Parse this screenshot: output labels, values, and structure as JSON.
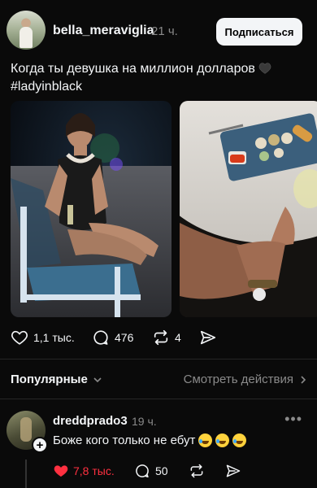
{
  "post": {
    "username": "bella_meraviglia",
    "time": "21 ч.",
    "subscribe_label": "Подписаться",
    "caption_line1": "Когда ты девушка на миллион долларов",
    "caption_line2": "#ladyinblack",
    "likes": "1,1 тыс.",
    "replies": "476",
    "reposts": "4"
  },
  "sort": {
    "label": "Популярные",
    "activity_link": "Смотреть действия"
  },
  "comment": {
    "username": "dreddprado3",
    "time": "19 ч.",
    "text": "Боже кого только не ебут",
    "likes": "7,8 тыс.",
    "replies": "50"
  },
  "colors": {
    "background": "#0a0a0a",
    "text": "#f3f5f7",
    "muted": "#8a8a8a",
    "like_active": "#ff3040"
  },
  "icons": [
    "heart-icon",
    "reply-icon",
    "repost-icon",
    "share-icon",
    "chevron-down-icon",
    "chevron-right-icon",
    "more-icon",
    "plus-icon"
  ]
}
